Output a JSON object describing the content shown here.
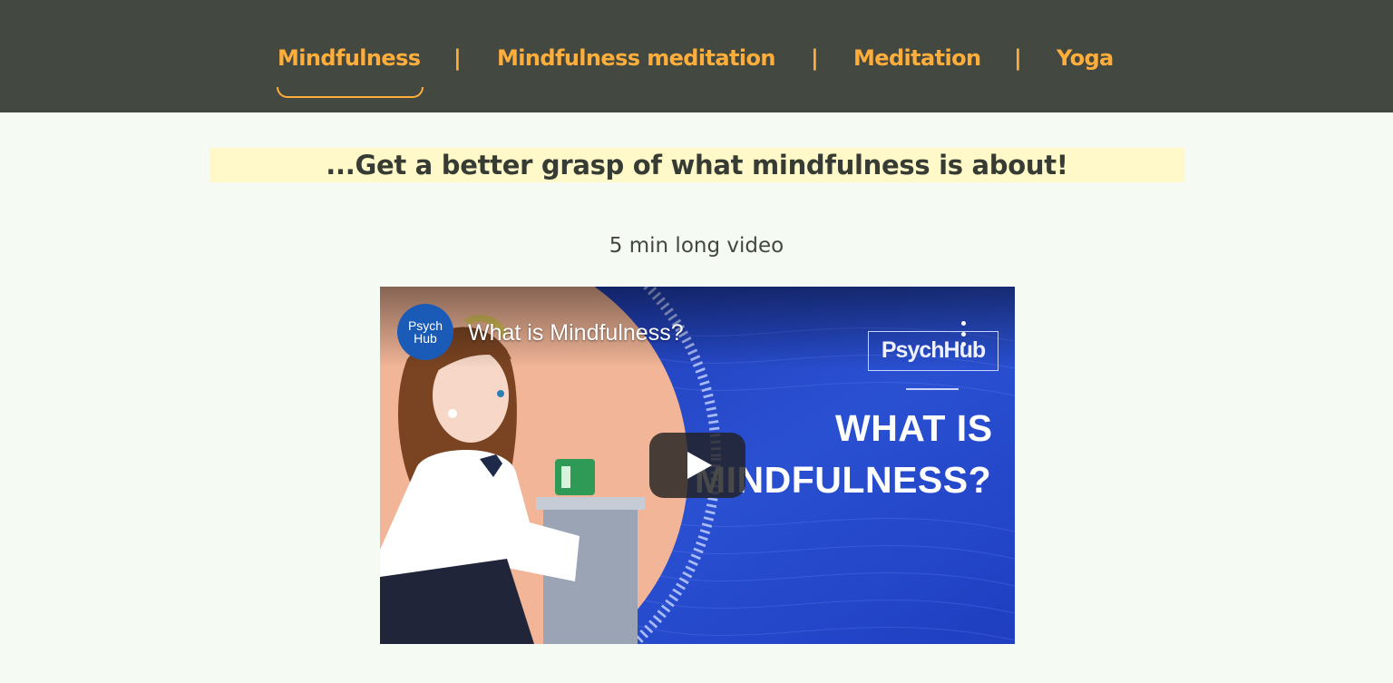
{
  "nav": {
    "items": [
      {
        "label": "Mindfulness",
        "active": true
      },
      {
        "label": "Mindfulness meditation",
        "active": false
      },
      {
        "label": "Meditation",
        "active": false
      },
      {
        "label": "Yoga",
        "active": false
      }
    ],
    "separator": "|"
  },
  "headline": "...Get a better grasp of what mindfulness is about!",
  "subtitle": "5 min long video",
  "video": {
    "title": "What is Mindfulness?",
    "channel_avatar_line1": "Psych",
    "channel_avatar_line2": "Hub",
    "brand_logo": "PsychHub",
    "thumbnail_heading_line1": "WHAT IS",
    "thumbnail_heading_line2": "MINDFULNESS?",
    "icons": {
      "play": "play-icon",
      "menu": "kebab-menu-icon"
    }
  },
  "colors": {
    "nav_background": "#434840",
    "nav_text": "#ffae3b",
    "page_background": "#f5fbf2",
    "highlight": "#fff8c8",
    "video_blue": "#2446c7"
  }
}
